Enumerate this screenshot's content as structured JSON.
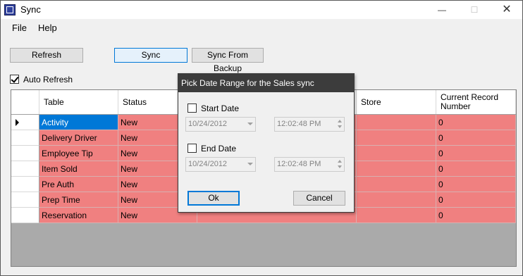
{
  "window": {
    "title": "Sync",
    "controls": {
      "minimize": "—",
      "maximize": "☐",
      "close": "✕"
    }
  },
  "menu": {
    "file": "File",
    "help": "Help"
  },
  "toolbar": {
    "refresh_label": "Refresh",
    "sync_label": "Sync",
    "sync_backup_label": "Sync From Backup",
    "auto_refresh_label": "Auto Refresh",
    "auto_refresh_checked": true
  },
  "grid": {
    "columns": {
      "table": "Table",
      "status": "Status",
      "store": "Store",
      "current_record": "Current Record Number"
    },
    "rows": [
      {
        "table": "Activity",
        "status": "New",
        "current": "0"
      },
      {
        "table": "Delivery Driver",
        "status": "New",
        "current": "0"
      },
      {
        "table": "Employee Tip",
        "status": "New",
        "current": "0"
      },
      {
        "table": "Item Sold",
        "status": "New",
        "current": "0"
      },
      {
        "table": "Pre Auth",
        "status": "New",
        "current": "0"
      },
      {
        "table": "Prep Time",
        "status": "New",
        "current": "0"
      },
      {
        "table": "Reservation",
        "status": "New",
        "current": "0"
      }
    ],
    "row_color": "#f08080",
    "selected_color": "#0078d7"
  },
  "dialog": {
    "title": "Pick Date Range for the Sales sync",
    "start_date_label": "Start Date",
    "start_date_value": "10/24/2012",
    "start_time_value": "12:02:48 PM",
    "end_date_label": "End Date",
    "end_date_value": "10/24/2012",
    "end_time_value": "12:02:48 PM",
    "ok_label": "Ok",
    "cancel_label": "Cancel"
  }
}
